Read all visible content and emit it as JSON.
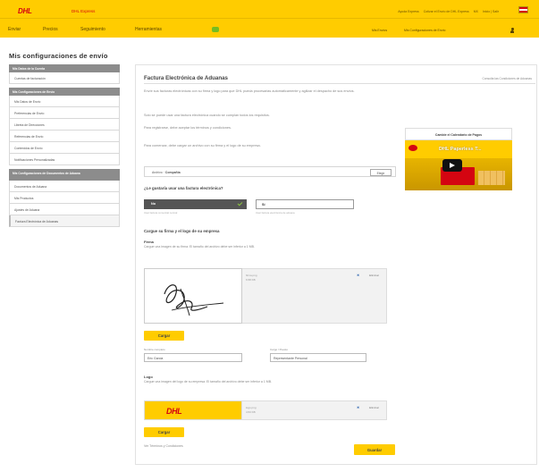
{
  "header": {
    "logo_text": "DHL",
    "logo_sub": "DHL Express",
    "top_links": [
      "Ayuda Express",
      "Cotizar el Envío de DHL Express",
      "MX",
      "Inicio | Salir"
    ],
    "flag_icon": "mexico-flag-icon"
  },
  "nav": {
    "items": [
      "Enviar",
      "Precios",
      "Seguimiento",
      "Herramientas"
    ],
    "right_links": [
      "Mis Envíos",
      "Mis Configuraciones de Envío"
    ],
    "user_icon": "user-icon"
  },
  "page": {
    "title": "Mis configuraciones de envío"
  },
  "sidebar": {
    "groups": [
      {
        "header": "Mis Datos de la Cuenta",
        "items": [
          "Cuentas de facturación"
        ]
      },
      {
        "header": "Mis Configuraciones de Envío",
        "items": [
          "Mis Datos de Envío",
          "Preferencias de Envío",
          "Libreta de Direcciones",
          "Referencias de Envío",
          "Contenidos de Envío",
          "Notificaciones Personalizadas"
        ]
      },
      {
        "header": "Mis Configuraciones de Documentos de Aduana",
        "items": [
          "Documentos de Aduana",
          "Mis Productos",
          "Ajustes de Aduana",
          "Factura Electrónica de Aduanas"
        ]
      }
    ]
  },
  "content": {
    "title": "Factura Electrónica de Aduanas",
    "top_link": "Consulta las Condiciones de Aduanas",
    "paragraphs": [
      "Envíe sus facturas electrónicas con su firma y logo para que DHL pueda procesarlas automáticamente y agilizar el despacho de sus envíos.",
      "Solo se puede usar una factura electrónica cuando se cumplan todos los requisitos.",
      "Para registrarse, debe aceptar los términos y condiciones.",
      "Para comenzar, debe cargar un archivo con su firma y el logo de su empresa."
    ],
    "file": {
      "label": "Archivo",
      "value": "Compañía",
      "button": "Elegir"
    },
    "question": "¿Le gustaría usar una factura electrónica?",
    "toggle_no": "No",
    "toggle_si": "Sí",
    "hint_no": "Usar factura comercial normal",
    "hint_si": "Usar factura electrónica de aduana",
    "upload_title": "Cargue su firma y el logo de su empresa",
    "firma": {
      "label": "Firma",
      "desc": "Cargue una imagen de su firma. El tamaño del archivo debe ser inferior a 1 MB.",
      "file_name": "firma.png",
      "file_meta": "6.58 KB",
      "delete_label": "Eliminar",
      "upload_button": "Cargar"
    },
    "names": {
      "name_label": "Nombre completo",
      "name_value": "Eric Garcia",
      "title_label": "Cargo / Puesto",
      "title_value": "Representante Personal"
    },
    "logo": {
      "label": "Logo",
      "desc": "Cargue una imagen del logo de su empresa. El tamaño del archivo debe ser inferior a 1 MB.",
      "file_name": "logo.png",
      "file_meta": "4.53 KB",
      "delete_label": "Eliminar",
      "upload_button": "Cargar"
    },
    "footer_link": "Ver Términos y Condiciones",
    "save_button": "Guardar"
  },
  "video": {
    "card_label": "Cambie el Calendario de Pagos",
    "title": "DHL Paperless T..."
  },
  "colors": {
    "brand_yellow": "#ffcc00",
    "brand_red": "#d40511",
    "accent_green": "#76bd22"
  }
}
